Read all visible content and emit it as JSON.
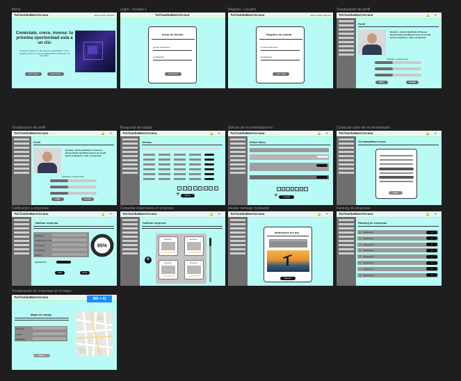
{
  "brand": "TuChambaMasCercana",
  "frame_labels": {
    "menu": "Menu",
    "login": "Login - Usuario 1",
    "registro": "Registro - Usuario",
    "vis_perfil_1": "Visualización de perfil",
    "vis_perfil_2": "Visualización de perfil",
    "busqueda": "Búsqueda de trabajo",
    "edicion": "Edición de recomendaciones",
    "contactar": "Contactar autor de recomendación",
    "calificacion": "Calificación a empresas",
    "comentar": "Comentar experiencia en empresa",
    "recibir": "Recibir mensaje motivador",
    "ranking": "Ranking de empresas",
    "mapa": "Visualización de empresas en el mapa"
  },
  "nav": {
    "links": "Iniciar Sesión  Registro"
  },
  "menu": {
    "hero_title": "Conéctate, crece, innova: tu próxima oportunidad está a un clic",
    "hero_text": "Conecta tu talento con las mejores oportunidades, y da el siguiente paso en tu carrera digital hacia un futuro lleno de innovación.",
    "btn_1": "Iniciar sesión",
    "btn_2": "Crear cuenta"
  },
  "login": {
    "title": "Inicio de Sesión",
    "email_label": "Correo electrónico",
    "password_label": "Contraseña",
    "button": "Iniciar sesión"
  },
  "registro": {
    "title": "Registro de cuenta",
    "email_label": "Correo electrónico",
    "password_label": "Contraseña",
    "button": "Crear cuenta"
  },
  "perfil": {
    "title": "Perfil",
    "person_text": "Nombre: Johnny MacPedro R Puesto: Desarrollador BackEnd Acerca de mí: Me gusta programar y salir a programar",
    "section": "Aptitudes y Experiencia",
    "edit_button": "Editar",
    "save_button": "Guardar"
  },
  "busqueda": {
    "title": "Ofertas",
    "pages": [
      "1",
      "2",
      "3",
      "4",
      "5",
      "6",
      "7",
      "8"
    ],
    "button": "Buscar"
  },
  "edicion": {
    "title": "Editar filtros",
    "pages": [
      "1",
      "2",
      "3",
      "4",
      "5",
      "6",
      "7"
    ],
    "button": "Guardar"
  },
  "contactar": {
    "title": "TuChambaMasCercana",
    "button": "Enviar"
  },
  "calificacion": {
    "title": "Calificar empresa",
    "fields": [
      "Empresa",
      "Calificación (1-10)",
      "Fortalezas",
      "Cualidades",
      "Salario"
    ],
    "approval_label": "Aprobación",
    "percent": "65%",
    "approval_value": 0.65,
    "btn_1": "Atrás",
    "btn_2": "Enviar"
  },
  "comentar": {
    "title": "Calificar empresa",
    "card_header": "Empresa",
    "stars": "★★★★★"
  },
  "recibir": {
    "title": "Motivación del día",
    "quote": "No hay que esperar a que pasen las cosas",
    "button": "Siguiente"
  },
  "ranking": {
    "title": "Ranking de empresas",
    "items": [
      "Empresa 1",
      "Empresa 2",
      "Empresa 3",
      "Empresa 4",
      "Empresa 5",
      "Empresa 6",
      "Empresa 7",
      "Empresa 8"
    ]
  },
  "mapa": {
    "zoom_readout": "385 × 41",
    "title": "Mapa de trabajo",
    "fields": [
      "Ubicación",
      "Puesto",
      "Modalidad"
    ],
    "button": "Buscar"
  },
  "colors": {
    "frame_bg": "#b8fbf6",
    "sidebar": "#6e6e6e",
    "zoom_badge": "#1a8cff"
  },
  "icons": [
    "bell-icon",
    "close-icon",
    "user-avatar-icon",
    "plus-icon",
    "star-icon",
    "map-icon"
  ]
}
